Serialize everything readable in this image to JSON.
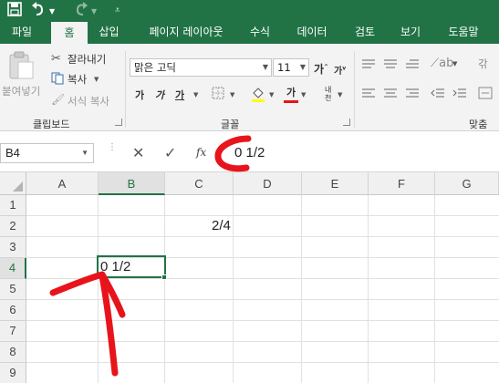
{
  "ribbon_tabs": [
    "파일",
    "홈",
    "삽입",
    "페이지 레이아웃",
    "수식",
    "데이터",
    "검토",
    "보기",
    "도움말"
  ],
  "active_tab": "홈",
  "clipboard": {
    "paste_label": "붙여넣기",
    "cut_label": "잘라내기",
    "copy_label": "복사",
    "format_painter_label": "서식 복사",
    "group_label": "클립보드"
  },
  "font": {
    "font_name": "맑은 고딕",
    "font_size": "11",
    "grow_font": "가",
    "shrink_font": "가",
    "bold": "가",
    "italic": "가",
    "underline": "가",
    "font_color": "가",
    "phonetic": "내천",
    "group_label": "글꼴"
  },
  "alignment": {
    "group_label": "맞춤",
    "wrap_label": "갂"
  },
  "formula_bar": {
    "name_box": "B4",
    "cancel_icon": "✕",
    "enter_icon": "✓",
    "fx_label": "fx",
    "formula": "0 1/2"
  },
  "grid": {
    "columns": [
      "A",
      "B",
      "C",
      "D",
      "E",
      "F",
      "G"
    ],
    "rows": [
      "1",
      "2",
      "3",
      "4",
      "5",
      "6",
      "7",
      "8",
      "9"
    ],
    "selected_cell": "B4",
    "cells": {
      "C2": "2/4",
      "B4": "0 1/2"
    }
  },
  "colors": {
    "excel_green": "#217346",
    "annotation_red": "#e8141b"
  }
}
